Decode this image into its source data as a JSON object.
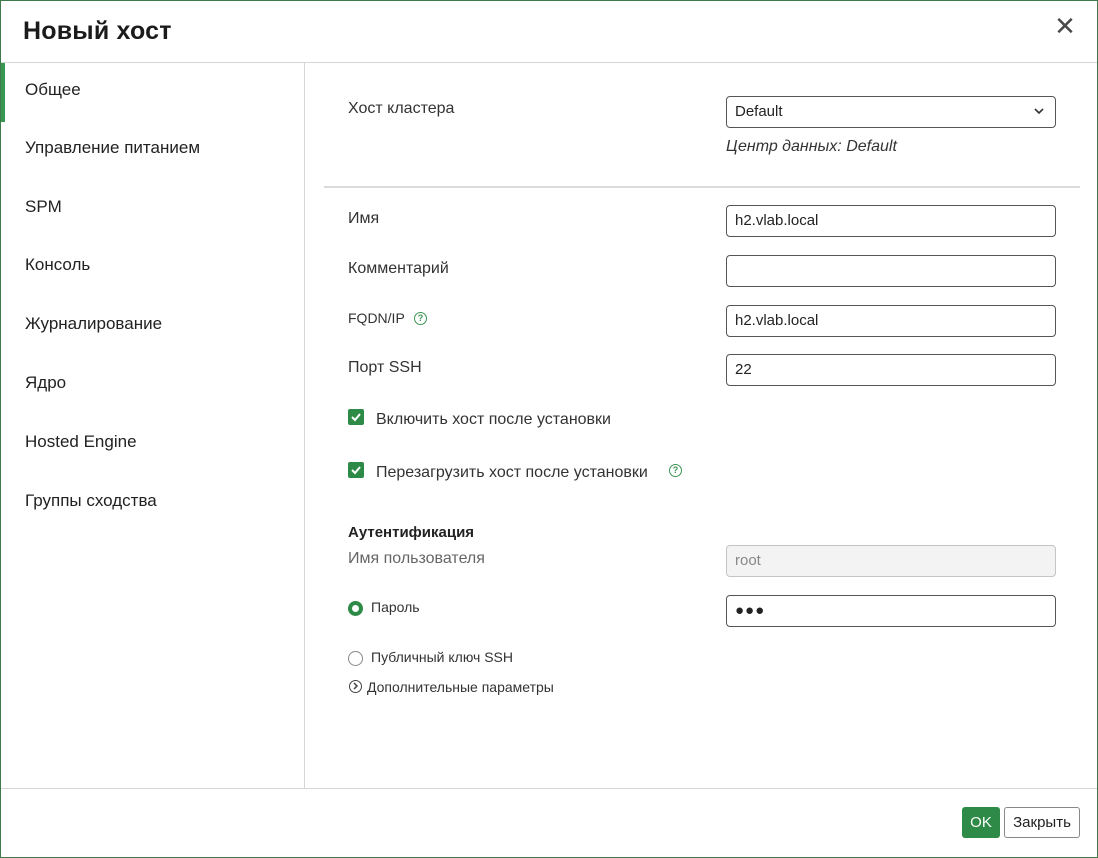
{
  "dialog": {
    "title": "Новый хост"
  },
  "sidebar": {
    "items": [
      {
        "label": "Общее",
        "active": true
      },
      {
        "label": "Управление питанием"
      },
      {
        "label": "SPM"
      },
      {
        "label": "Консоль"
      },
      {
        "label": "Журналирование"
      },
      {
        "label": "Ядро"
      },
      {
        "label": "Hosted Engine"
      },
      {
        "label": "Группы сходства"
      }
    ]
  },
  "form": {
    "cluster_label": "Хост кластера",
    "cluster_value": "Default",
    "datacenter_note": "Центр данных: Default",
    "name_label": "Имя",
    "name_value": "h2.vlab.local",
    "comment_label": "Комментарий",
    "comment_value": "",
    "fqdn_label": "FQDN/IP",
    "fqdn_value": "h2.vlab.local",
    "ssh_port_label": "Порт SSH",
    "ssh_port_value": "22",
    "activate_label": "Включить хост после установки",
    "activate_checked": true,
    "reboot_label": "Перезагрузить хост после установки",
    "reboot_checked": true
  },
  "auth": {
    "section_title": "Аутентификация",
    "username_label": "Имя пользователя",
    "username_value": "root",
    "password_label": "Пароль",
    "password_value": "●●●",
    "ssh_key_label": "Публичный ключ SSH",
    "selected_method": "password",
    "advanced_label": "Дополнительные параметры"
  },
  "footer": {
    "ok_label": "OK",
    "close_label": "Закрыть"
  },
  "colors": {
    "accent": "#2e8b47",
    "border": "#3f7a4a"
  },
  "icons": {
    "close": "close-icon",
    "help": "help-circle-icon",
    "chevron": "chevron-down-icon",
    "expand": "chevron-right-circle-icon"
  }
}
